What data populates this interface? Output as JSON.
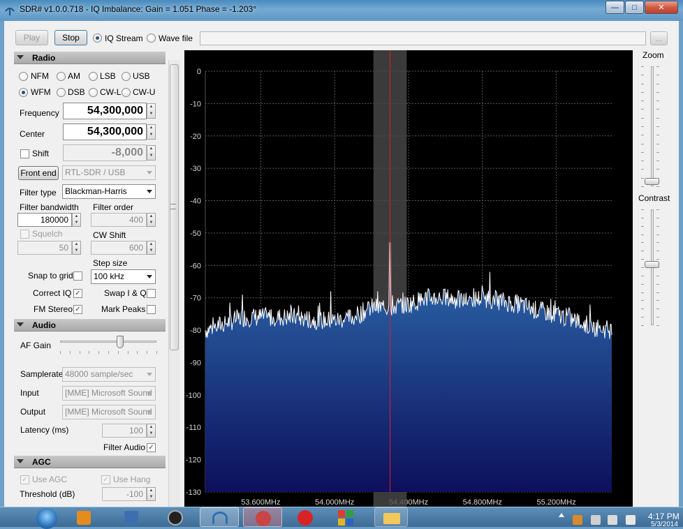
{
  "window": {
    "title": "SDR# v1.0.0.718 - IQ Imbalance: Gain = 1.051 Phase = -1.203°",
    "minimize_glyph": "—",
    "maximize_glyph": "□",
    "close_glyph": "✕"
  },
  "toolbar": {
    "play_label": "Play",
    "stop_label": "Stop",
    "source_options": [
      "IQ Stream",
      "Wave file"
    ],
    "selected_source": "IQ Stream",
    "file_path": "",
    "browse_label": "..."
  },
  "radio": {
    "header": "Radio",
    "modes": [
      "NFM",
      "AM",
      "LSB",
      "USB",
      "WFM",
      "DSB",
      "CW-L",
      "CW-U"
    ],
    "selected_mode": "WFM",
    "frequency_label": "Frequency",
    "frequency_value": "54,300,000",
    "center_label": "Center",
    "center_value": "54,300,000",
    "shift_label": "Shift",
    "shift_checked": false,
    "shift_value": "-8,000",
    "front_end_label": "Front end",
    "front_end_value": "RTL-SDR / USB",
    "filter_type_label": "Filter type",
    "filter_type_value": "Blackman-Harris",
    "filter_bandwidth_label": "Filter bandwidth",
    "filter_bandwidth_value": "180000",
    "filter_order_label": "Filter order",
    "filter_order_value": "400",
    "squelch_label": "Squelch",
    "squelch_value": "50",
    "cw_shift_label": "CW Shift",
    "cw_shift_value": "600",
    "step_size_label": "Step size",
    "step_size_value": "100 kHz",
    "snap_to_grid_label": "Snap to grid",
    "snap_to_grid_checked": false,
    "correct_iq_label": "Correct IQ",
    "correct_iq_checked": true,
    "swap_iq_label": "Swap I & Q",
    "swap_iq_checked": false,
    "fm_stereo_label": "FM Stereo",
    "fm_stereo_checked": true,
    "mark_peaks_label": "Mark Peaks",
    "mark_peaks_checked": false
  },
  "audio": {
    "header": "Audio",
    "af_gain_label": "AF Gain",
    "af_gain_level": 0.62,
    "samplerate_label": "Samplerate",
    "samplerate_value": "48000 sample/sec",
    "input_label": "Input",
    "input_value": "[MME] Microsoft Sound",
    "output_label": "Output",
    "output_value": "[MME] Microsoft Sound",
    "latency_label": "Latency (ms)",
    "latency_value": "100",
    "filter_audio_label": "Filter Audio",
    "filter_audio_checked": true
  },
  "agc": {
    "header": "AGC",
    "use_agc_label": "Use AGC",
    "use_hang_label": "Use Hang",
    "threshold_label": "Threshold (dB)",
    "threshold_value": "-100"
  },
  "right_panel": {
    "zoom_label": "Zoom",
    "contrast_label": "Contrast",
    "zoom_level": 0.0,
    "contrast_level": 0.52
  },
  "taskbar": {
    "clock_time": "4:17 PM",
    "clock_date": "5/3/2014"
  },
  "colors": {
    "spectrum_fill_top": "#2f6fb0",
    "spectrum_fill_bottom": "#0d0f5c",
    "spectrum_trace": "#ffffff",
    "tuning_line": "#e02020",
    "filter_band": "#4a4a4a"
  },
  "chart_data": {
    "type": "area",
    "xlabel": "",
    "ylabel": "",
    "x_unit": "MHz",
    "xlim": [
      53.3,
      55.5
    ],
    "ylim": [
      -130,
      0
    ],
    "y_ticks": [
      0,
      -10,
      -20,
      -30,
      -40,
      -50,
      -60,
      -70,
      -80,
      -90,
      -100,
      -110,
      -120,
      -130
    ],
    "x_ticks": [
      "53.600MHz",
      "54.000MHz",
      "54.400MHz",
      "54.800MHz",
      "55.200MHz"
    ],
    "x_tick_values": [
      53.6,
      54.0,
      54.4,
      54.8,
      55.2
    ],
    "center_frequency": 54.3,
    "filter_band": [
      54.21,
      54.39
    ],
    "grid": true,
    "series": [
      {
        "x": [
          53.3,
          53.4,
          53.5,
          53.6,
          53.7,
          53.8,
          53.9,
          54.0,
          54.1,
          54.2,
          54.3,
          54.4,
          54.5,
          54.6,
          54.7,
          54.8,
          54.9,
          55.0,
          55.1,
          55.2,
          55.3,
          55.4,
          55.5
        ],
        "values": [
          -80,
          -78,
          -76,
          -76,
          -76,
          -76,
          -77,
          -77,
          -76,
          -73,
          -73,
          -72,
          -70,
          -70,
          -71,
          -70,
          -71,
          -72,
          -74,
          -75,
          -77,
          -79,
          -80
        ]
      }
    ],
    "peaks": [
      {
        "x": 53.5,
        "y": -69
      },
      {
        "x": 53.98,
        "y": -68
      },
      {
        "x": 54.3,
        "y": -53
      },
      {
        "x": 54.84,
        "y": -62
      }
    ]
  }
}
